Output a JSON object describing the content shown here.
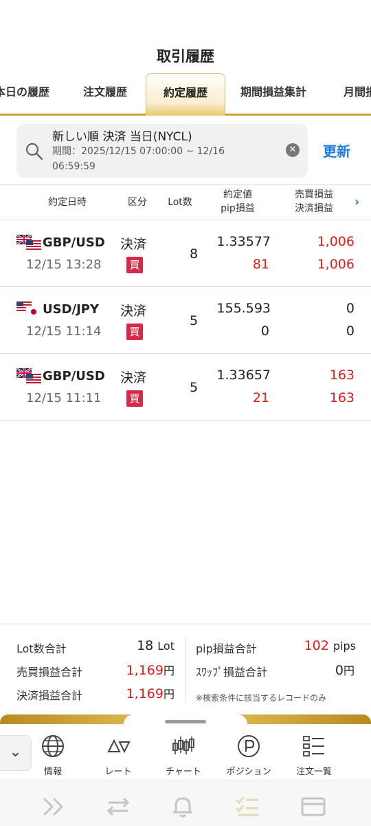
{
  "header": {
    "title": "取引履歴"
  },
  "tabs": [
    {
      "label": "本日の履歴"
    },
    {
      "label": "注文履歴"
    },
    {
      "label": "約定履歴"
    },
    {
      "label": "期間損益集計"
    },
    {
      "label": "月間損"
    }
  ],
  "filter": {
    "line1": "新しい順 決済 当日(NYCL)",
    "line2": "期間：2025/12/15 07:00:00 ~ 12/16 06:59:59",
    "refresh_label": "更新"
  },
  "table": {
    "headers": {
      "datetime": "約定日時",
      "kubun": "区分",
      "lot": "Lot数",
      "price_line1": "約定値",
      "price_line2": "pip損益",
      "pl_line1": "売買損益",
      "pl_line2": "決済損益"
    },
    "rows": [
      {
        "pair": "GBP/USD",
        "time": "12/15 13:28",
        "kubun": "決済",
        "side": "買",
        "lot": "8",
        "price": "1.33577",
        "pip": "81",
        "trade_pl": "1,006",
        "settle_pl": "1,006"
      },
      {
        "pair": "USD/JPY",
        "time": "12/15 11:14",
        "kubun": "決済",
        "side": "買",
        "lot": "5",
        "price": "155.593",
        "pip": "0",
        "trade_pl": "0",
        "settle_pl": "0"
      },
      {
        "pair": "GBP/USD",
        "time": "12/15 11:11",
        "kubun": "決済",
        "side": "買",
        "lot": "5",
        "price": "1.33657",
        "pip": "21",
        "trade_pl": "163",
        "settle_pl": "163"
      }
    ]
  },
  "summary": {
    "lot_label": "Lot数合計",
    "lot_value": "18",
    "lot_unit": "Lot",
    "trade_label": "売買損益合計",
    "trade_value": "1,169",
    "trade_unit": "円",
    "settle_label": "決済損益合計",
    "settle_value": "1,169",
    "settle_unit": "円",
    "pip_label": "pip損益合計",
    "pip_value": "102",
    "pip_unit": "pips",
    "swap_label": "ｽﾜｯﾌﾟ損益合計",
    "swap_value": "0",
    "swap_unit": "円",
    "note": "※検索条件に該当するレコードのみ"
  },
  "nav": {
    "items": [
      {
        "label": "情報",
        "icon": "globe-icon"
      },
      {
        "label": "レート",
        "icon": "rate-triangles-icon"
      },
      {
        "label": "チャート",
        "icon": "candlestick-icon"
      },
      {
        "label": "ポジション",
        "icon": "position-p-icon"
      },
      {
        "label": "注文一覧",
        "icon": "order-list-icon"
      }
    ]
  },
  "colors": {
    "accent": "#1e7fe0",
    "gold": "#c9a13a",
    "profit": "#e11b1b",
    "buy_badge": "#d6294a"
  }
}
